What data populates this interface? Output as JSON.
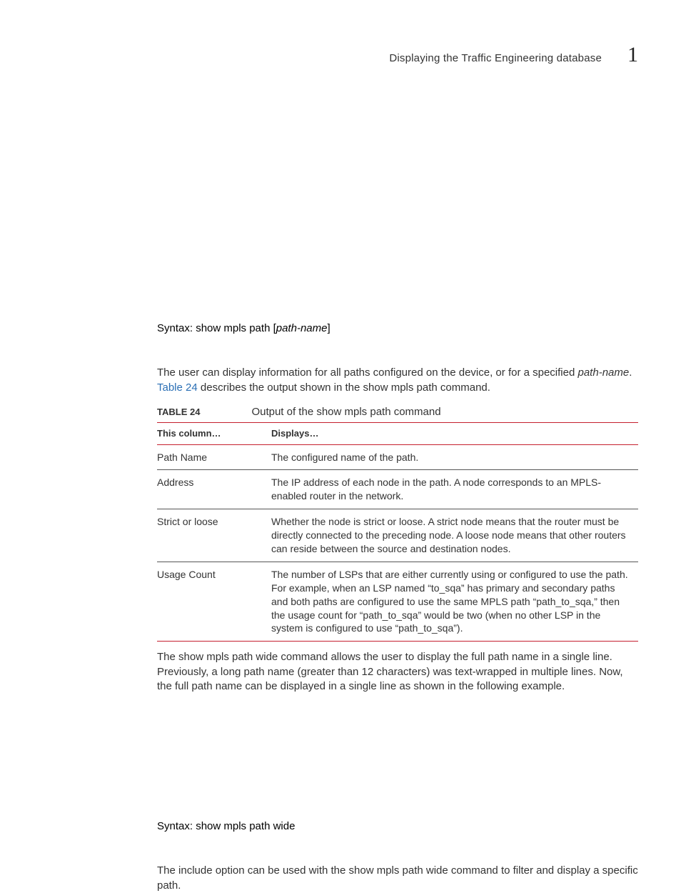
{
  "header": {
    "section_title": "Displaying the Traffic Engineering database",
    "chapter_number": "1"
  },
  "body": {
    "syntax1_prefix": "Syntax:  show mpls path [",
    "syntax1_var": "path-name",
    "syntax1_suffix": "]",
    "para1_pre": "The user can display information for all paths configured on the device, or for a specified ",
    "para1_italic": "path-name",
    "para1_mid": ". ",
    "para1_link": "Table 24",
    "para1_post": " describes the output shown in the show mpls path command.",
    "table_caption_label": "TABLE 24",
    "table_caption_text": "Output of the show mpls path command",
    "table_head_col1": "This column…",
    "table_head_col2": "Displays…",
    "rows": [
      {
        "c1": "Path Name",
        "c2": "The configured name of the path."
      },
      {
        "c1": "Address",
        "c2": "The IP address of each node in the path. A node corresponds to an MPLS-enabled router in the network."
      },
      {
        "c1": "Strict or loose",
        "c2": "Whether the node is strict or loose. A strict node means that the router must be directly connected to the preceding node. A loose node means that other routers can reside between the source and destination nodes."
      },
      {
        "c1": "Usage Count",
        "c2": "The number of LSPs that are either currently using or configured to use the path. For example, when an LSP named “to_sqa” has primary and secondary paths and both paths are configured to use the same MPLS path “path_to_sqa,” then the usage count for “path_to_sqa” would be two (when no other LSP in the system is configured to use “path_to_sqa”)."
      }
    ],
    "para2": "The show mpls path wide command allows the user to display the full path name in a single line. Previously, a long path name (greater than 12 characters) was text-wrapped in multiple lines. Now, the full path name can be displayed in a single line as shown in the following example.",
    "syntax2": "Syntax:  show mpls path wide",
    "para3": "The include option can be used with the show mpls path wide command to filter and display a specific path."
  }
}
